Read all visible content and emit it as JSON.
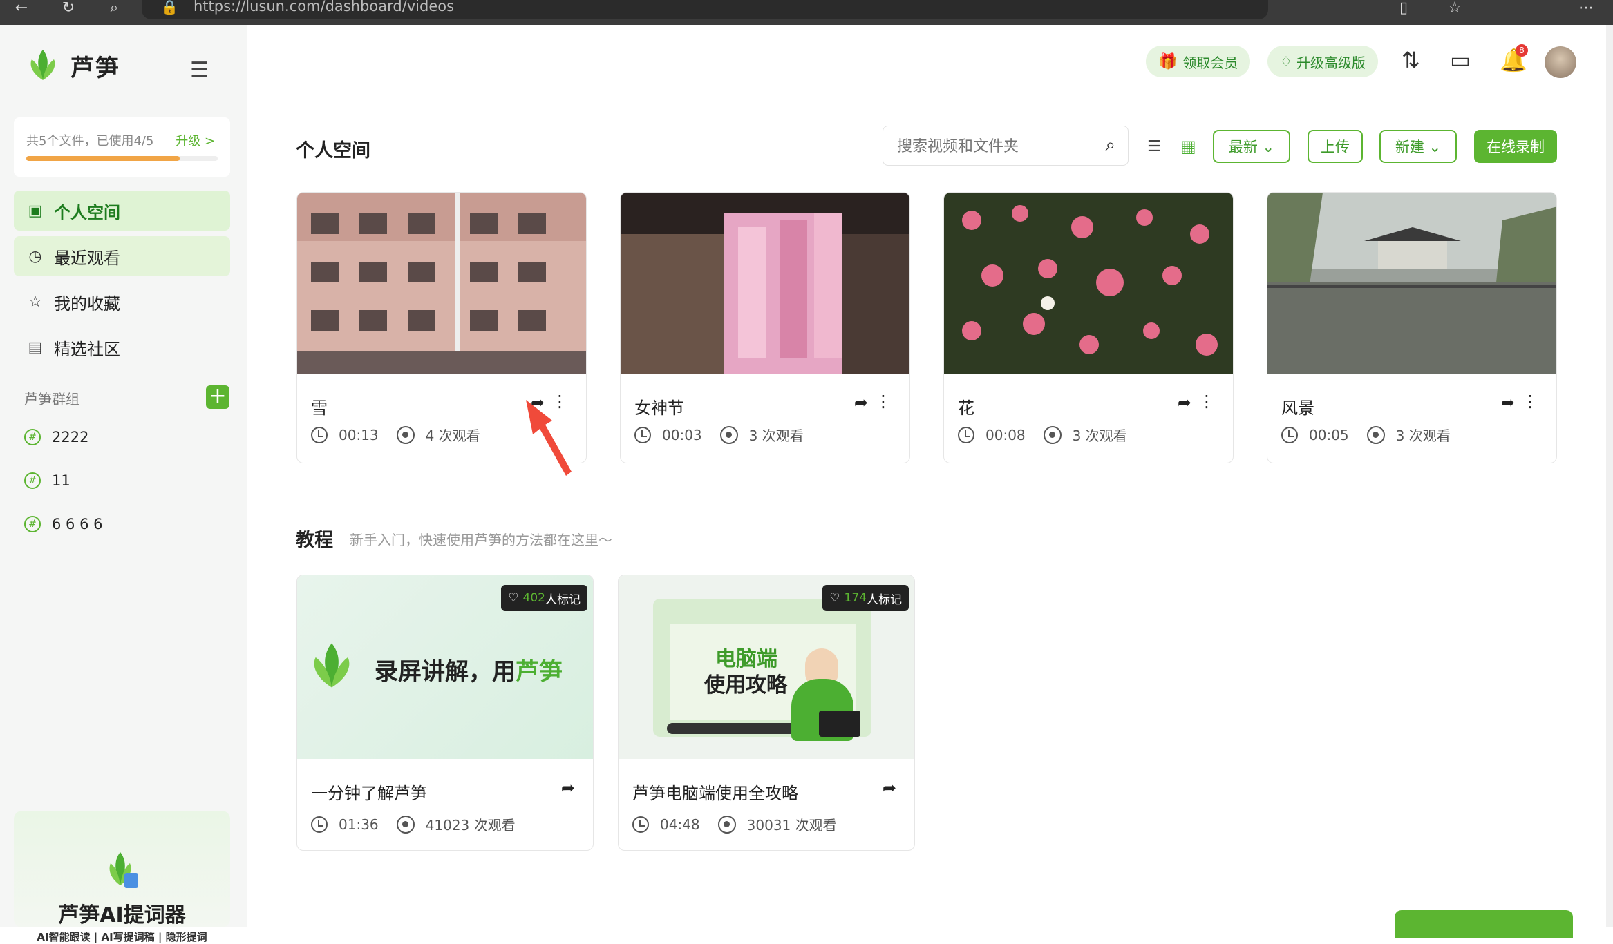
{
  "browser": {
    "url": "https://lusun.com/dashboard/videos"
  },
  "brand": {
    "name": "芦笋",
    "accent": "#5cb531"
  },
  "storage": {
    "text": "共5个文件，已使用4/5",
    "upgrade": "升级 >",
    "used_fraction": 0.8
  },
  "sidebar": {
    "items": [
      {
        "label": "个人空间",
        "icon": "folder-video-icon",
        "active": true
      },
      {
        "label": "最近观看",
        "icon": "clock-icon"
      },
      {
        "label": "我的收藏",
        "icon": "star-icon"
      },
      {
        "label": "精选社区",
        "icon": "community-icon"
      }
    ],
    "groups_title": "芦笋群组",
    "groups": [
      "2222",
      "11",
      "6 6 6 6"
    ]
  },
  "promo": {
    "title": "芦笋AI提词器",
    "subtitle": "AI智能跟读 | AI写提词稿 | 隐形提词"
  },
  "header": {
    "member": "领取会员",
    "upgrade": "升级高级版",
    "notification_count": "8"
  },
  "main": {
    "title": "个人空间",
    "search_placeholder": "搜索视频和文件夹",
    "sort": "最新 ⌄",
    "upload": "上传",
    "new": "新建 ⌄",
    "record": "在线录制",
    "videos": [
      {
        "title": "雪",
        "duration": "00:13",
        "views": "4 次观看"
      },
      {
        "title": "女神节",
        "duration": "00:03",
        "views": "3 次观看"
      },
      {
        "title": "花",
        "duration": "00:08",
        "views": "3 次观看"
      },
      {
        "title": "风景",
        "duration": "00:05",
        "views": "3 次观看"
      }
    ]
  },
  "tutorials": {
    "title": "教程",
    "subtitle": "新手入门，快速使用芦笋的方法都在这里～",
    "items": [
      {
        "title": "一分钟了解芦笋",
        "duration": "01:36",
        "views": "41023 次观看",
        "mark_count": "402",
        "mark_label": "人标记",
        "thumb_text_a": "录屏讲解，用",
        "thumb_text_b": "芦笋"
      },
      {
        "title": "芦笋电脑端使用全攻略",
        "duration": "04:48",
        "views": "30031 次观看",
        "mark_count": "174",
        "mark_label": "人标记",
        "thumb_line1": "电脑端",
        "thumb_line2": "使用攻略"
      }
    ]
  }
}
